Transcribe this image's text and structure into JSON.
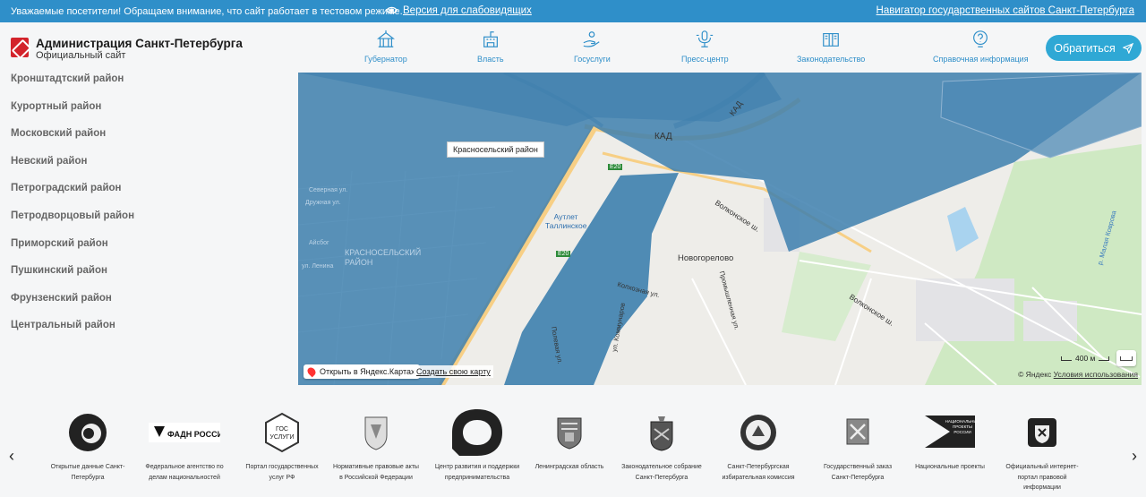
{
  "topbar": {
    "notice": "Уважаемые посетители! Обращаем внимание, что сайт работает в тестовом режиме.",
    "vision_link": "Версия для слабовидящих",
    "navigator_link": "Навигатор государственных сайтов Санкт-Петербурга"
  },
  "header": {
    "title": "Администрация Санкт-Петербурга",
    "subtitle": "Официальный сайт",
    "nav": [
      {
        "label": "Губернатор",
        "icon": "governor-building-icon"
      },
      {
        "label": "Власть",
        "icon": "government-building-icon"
      },
      {
        "label": "Госуслуги",
        "icon": "hand-service-icon"
      },
      {
        "label": "Пресс-центр",
        "icon": "microphone-icon"
      },
      {
        "label": "Законодательство",
        "icon": "law-book-icon"
      },
      {
        "label": "Справочная информация",
        "icon": "question-icon"
      }
    ],
    "appeal_button": "Обратиться"
  },
  "districts": [
    "Кронштадтский район",
    "Курортный район",
    "Московский район",
    "Невский район",
    "Петроградский район",
    "Петродворцовый район",
    "Приморский район",
    "Пушкинский район",
    "Фрунзенский район",
    "Центральный район"
  ],
  "map": {
    "tooltip": "Красносельский район",
    "district_label": "КРАСНОСЕЛЬСКИЙ РАЙОН",
    "labels": {
      "kad": "КАД",
      "kad_rotated": "КАД",
      "e20_top": "E20",
      "e20_mid": "E20",
      "outlet": "Аутлет Таллинское",
      "novogorelovo": "Новогорелово",
      "volkonskoe_1": "Волконское ш.",
      "volkonskoe_2": "Волконское ш.",
      "severnaya": "Северная ул.",
      "druzhnaya": "Дружная ул.",
      "aysbog": "Айсбог",
      "lenina": "ул. Ленина",
      "polevaya": "Полевая ул.",
      "kommunarov": "ул. Коммунаров",
      "kolkhoznaya": "Колхозная ул.",
      "promyshlennaya": "Промышленная ул.",
      "malaya_kovrovka": "р. Малая Коврова"
    },
    "open_in_yandex": "Открыть в Яндекс.Картах",
    "create_map": "Создать свою карту",
    "scale": "400 м",
    "copyright": "© Яндекс",
    "terms": "Условия использования"
  },
  "partners": [
    {
      "name": "Открытые данные Санкт-Петербурга",
      "logo": "open-data-logo"
    },
    {
      "name": "Федеральное агентство по делам национальностей",
      "logo": "fadn-logo",
      "logo_text": "ФАДН РОССИИ"
    },
    {
      "name": "Портал государственных услуг РФ",
      "logo": "gosuslugi-logo",
      "logo_text": "ГОС УСЛУГИ"
    },
    {
      "name": "Нормативные правовые акты в Российской Федерации",
      "logo": "legal-acts-emblem"
    },
    {
      "name": "Центр развития и поддержки предпринимательства",
      "logo": "business-center-logo"
    },
    {
      "name": "Ленинградская область",
      "logo": "leningrad-region-emblem"
    },
    {
      "name": "Законодательное собрание Санкт-Петербурга",
      "logo": "legislative-assembly-emblem"
    },
    {
      "name": "Санкт-Петербургская избирательная комиссия",
      "logo": "election-commission-emblem"
    },
    {
      "name": "Государственный заказ Санкт-Петербурга",
      "logo": "state-order-emblem"
    },
    {
      "name": "Национальные проекты",
      "logo": "national-projects-logo",
      "logo_text": "НАЦИОНАЛЬНЫЕ ПРОЕКТЫ РОССИИ"
    },
    {
      "name": "Официальный интернет-портал правовой информации",
      "logo": "legal-portal-emblem"
    }
  ]
}
